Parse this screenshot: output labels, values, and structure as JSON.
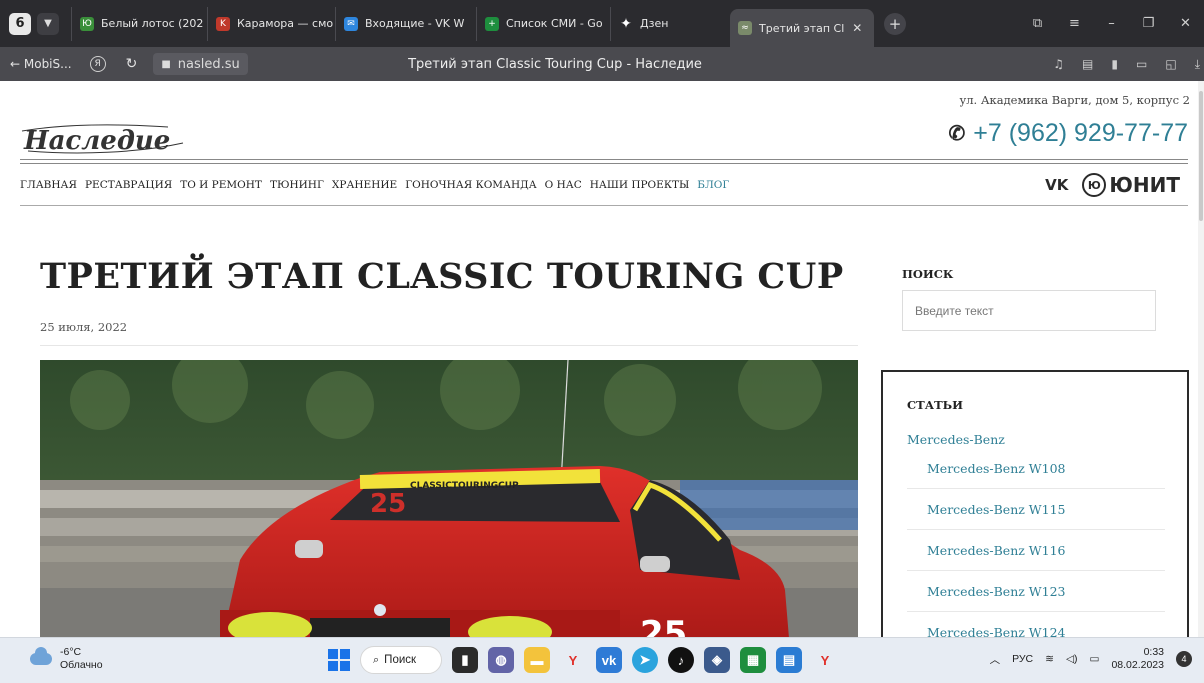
{
  "browser": {
    "tab_count": "6",
    "tabs": [
      {
        "label": "Белый лотос (202",
        "icon": "lotus-icon",
        "color": "#3a8f3a"
      },
      {
        "label": "Карамора — смо",
        "icon": "karamora-icon",
        "color": "#c0392b"
      },
      {
        "label": "Входящие - VK W",
        "icon": "mail-icon",
        "color": "#2e86de"
      },
      {
        "label": "Список СМИ - Go",
        "icon": "sheets-icon",
        "color": "#1e8e3e"
      },
      {
        "label": "Дзен",
        "icon": "dzen-icon",
        "color": "#222222"
      },
      {
        "label": "Третий этап Cl",
        "icon": "site-icon",
        "color": "#7a8a6a",
        "active": true
      }
    ],
    "back_label": "← MobiS...",
    "url": "nasled.su",
    "page_title": "Третий этап Classic Touring Cup - Наследие"
  },
  "site": {
    "logo_text": "Наследие",
    "address": "ул. Академика Варги, дом 5, корпус 2",
    "phone": "+7 (962) 929-77-77",
    "nav": [
      {
        "label": "ГЛАВНАЯ"
      },
      {
        "label": "РЕСТАВРАЦИЯ"
      },
      {
        "label": "ТО И РЕМОНТ"
      },
      {
        "label": "ТЮНИНГ"
      },
      {
        "label": "ХРАНЕНИЕ"
      },
      {
        "label": "ГОНОЧНАЯ КОМАНДА"
      },
      {
        "label": "О НАС"
      },
      {
        "label": "НАШИ ПРОЕКТЫ"
      },
      {
        "label": "БЛОГ",
        "active": true
      }
    ],
    "social_vk": "VK",
    "partner": "ЮНИТ",
    "accent_color": "#2f7f95"
  },
  "article": {
    "title": "ТРЕТИЙ ЭТАП CLASSIC TOURING CUP",
    "date": "25 июля, 2022",
    "photo_banner": "CLASSICTOURINGCUP",
    "car_number": "25"
  },
  "sidebar": {
    "search_title": "ПОИСК",
    "search_placeholder": "Введите текст",
    "articles_title": "СТАТЬИ",
    "category": "Mercedes-Benz",
    "items": [
      "Mercedes-Benz W108",
      "Mercedes-Benz W115",
      "Mercedes-Benz W116",
      "Mercedes-Benz W123",
      "Mercedes-Benz W124"
    ]
  },
  "taskbar": {
    "temp": "-6°C",
    "weather": "Облачно",
    "search_label": "Поиск",
    "lang": "РУС",
    "time": "0:33",
    "date": "08.02.2023",
    "notifications": "4"
  }
}
